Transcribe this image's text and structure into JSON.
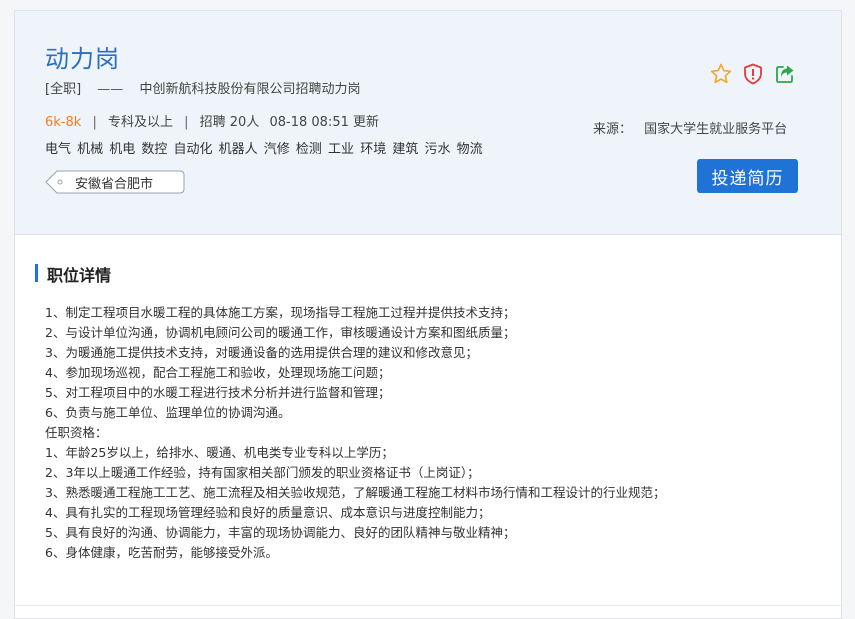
{
  "job": {
    "title": "动力岗",
    "type": "[全职]",
    "dash": "——",
    "company_line": "中创新航科技股份有限公司招聘动力岗",
    "salary": "6k-8k",
    "separator": "|",
    "education": "专科及以上",
    "headcount": "招聘 20人",
    "updated": "08-18 08:51 更新",
    "tags": "电气 机械 机电 数控 自动化 机器人 汽修 检测 工业 环境 建筑 污水 物流",
    "location": "安徽省合肥市"
  },
  "source": {
    "label": "来源：",
    "value": "国家大学生就业服务平台"
  },
  "actions": {
    "apply_label": "投递简历"
  },
  "icons": {
    "favorite": "star-icon",
    "report": "shield-alert-icon",
    "share": "share-icon"
  },
  "colors": {
    "accent": "#1f72d6",
    "title": "#2b6fc2",
    "salary": "#ff7a1a",
    "star": "#f5a623",
    "report": "#e63b3b",
    "share": "#2aa84a"
  },
  "detail": {
    "section_title": "职位详情",
    "lines": [
      "1、制定工程项目水暖工程的具体施工方案，现场指导工程施工过程并提供技术支持；",
      "2、与设计单位沟通，协调机电顾问公司的暖通工作，审核暖通设计方案和图纸质量；",
      "3、为暖通施工提供技术支持，对暖通设备的选用提供合理的建议和修改意见；",
      "4、参加现场巡视，配合工程施工和验收，处理现场施工问题；",
      "5、对工程项目中的水暖工程进行技术分析并进行监督和管理；",
      "6、负责与施工单位、监理单位的协调沟通。",
      "任职资格：",
      "1、年龄25岁以上，给排水、暖通、机电类专业专科以上学历；",
      "2、3年以上暖通工作经验，持有国家相关部门颁发的职业资格证书（上岗证）；",
      "3、熟悉暖通工程施工工艺、施工流程及相关验收规范，了解暖通工程施工材料市场行情和工程设计的行业规范；",
      "4、具有扎实的工程现场管理经验和良好的质量意识、成本意识与进度控制能力；",
      "5、具有良好的沟通、协调能力，丰富的现场协调能力、良好的团队精神与敬业精神；",
      "6、身体健康，吃苦耐劳，能够接受外派。"
    ]
  }
}
